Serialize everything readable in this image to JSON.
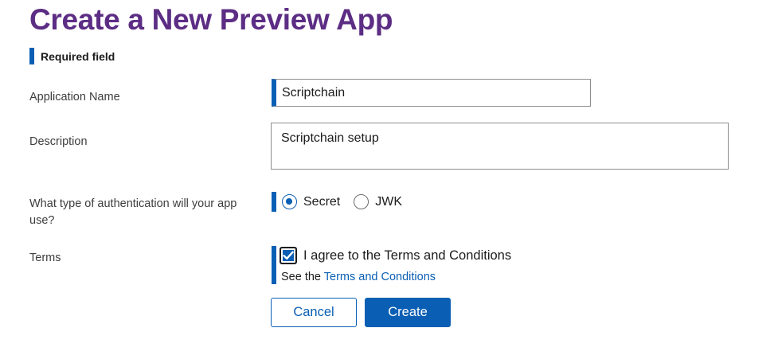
{
  "page_title": "Create a New Preview App",
  "required_note": "Required field",
  "fields": {
    "app_name": {
      "label": "Application Name",
      "value": "Scriptchain"
    },
    "description": {
      "label": "Description",
      "value": "Scriptchain setup"
    },
    "auth": {
      "label": "What type of authentication will your app use?",
      "options": [
        {
          "label": "Secret",
          "selected": true
        },
        {
          "label": "JWK",
          "selected": false
        }
      ]
    },
    "terms": {
      "label": "Terms",
      "checkbox_label": "I agree to the Terms and Conditions",
      "checked": true,
      "see_prefix": "See the",
      "link_text": "Terms and Conditions"
    }
  },
  "buttons": {
    "cancel": "Cancel",
    "create": "Create"
  },
  "colors": {
    "title": "#5c2d84",
    "accent": "#0a5fb4"
  }
}
